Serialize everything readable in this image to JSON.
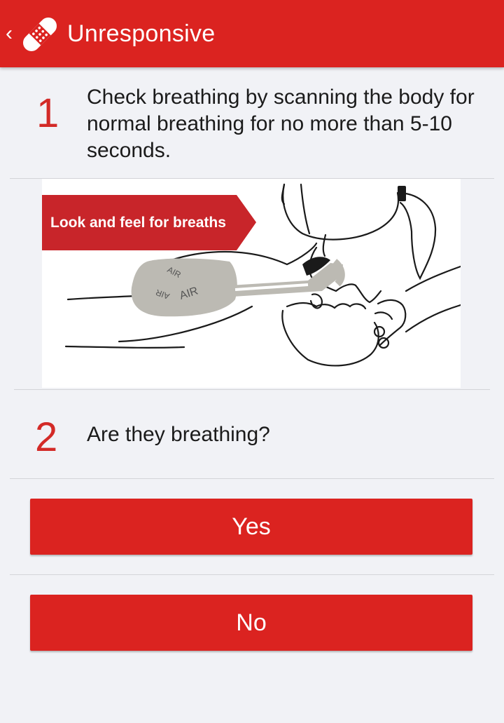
{
  "header": {
    "back_label": "‹",
    "title": "Unresponsive",
    "logo_icon": "bandage-icon",
    "background_color": "#db2320"
  },
  "steps": [
    {
      "number": "1",
      "text": "Check breathing by scanning the body for normal breathing for no more than 5-10 seconds."
    },
    {
      "number": "2",
      "text": "Are they breathing?"
    }
  ],
  "illustration": {
    "banner_label": "Look and feel for breaths",
    "air_labels": [
      "AIR",
      "AIR",
      "AIR"
    ]
  },
  "answers": {
    "yes_label": "Yes",
    "no_label": "No"
  },
  "colors": {
    "accent": "#db2320",
    "step_number": "#d32a27",
    "background": "#f1f2f6"
  }
}
